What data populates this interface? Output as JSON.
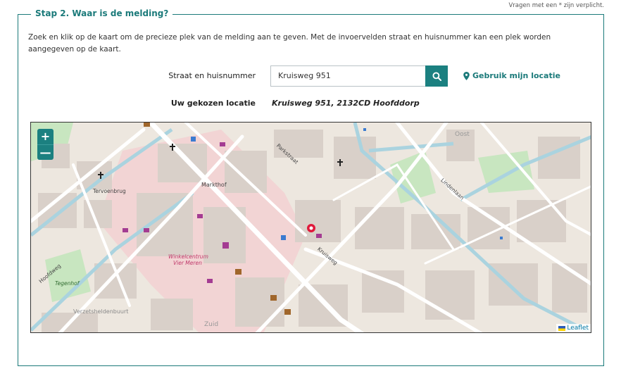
{
  "required_note": "Vragen met een * zijn verplicht.",
  "step": {
    "legend": "Stap 2. Waar is de melding?",
    "intro": "Zoek en klik op de kaart om de precieze plek van de melding aan te geven. Met de invoervelden straat en huisnummer kan een plek worden aangegeven op de kaart.",
    "address_label": "Straat en huisnummer",
    "address_value": "Kruisweg 951",
    "search_icon": "search-icon",
    "location_link": "Gebruik mijn locatie",
    "location_icon": "map-marker-icon",
    "chosen_label": "Uw gekozen locatie",
    "chosen_value": "Kruisweg 951, 2132CD Hoofddorp"
  },
  "map": {
    "zoom_in": "+",
    "zoom_out": "—",
    "attribution": "Leaflet",
    "labels": {
      "tervoenbrug": "Tervoenbrug",
      "markthof": "Markthof",
      "winkelcentrum": "Winkelcentrum",
      "vier_meren": "Vier Meren",
      "oost": "Oost",
      "zuid": "Zuid",
      "verzetsheldenbuurt": "Verzetsheldenbuurt",
      "tegenhof": "Tegenhof",
      "kruisweg": "Kruisweg",
      "parkstraat": "Parkstraat",
      "hoofdweg": "Hoofdweg",
      "lindenlaan": "Lindenlaan"
    },
    "colors": {
      "water": "#aad3df",
      "park": "#c8e6c0",
      "pedestrian": "#f2d4d4",
      "road": "#ffffff",
      "building": "#d9d0c9",
      "marker": "#e0193b"
    }
  }
}
